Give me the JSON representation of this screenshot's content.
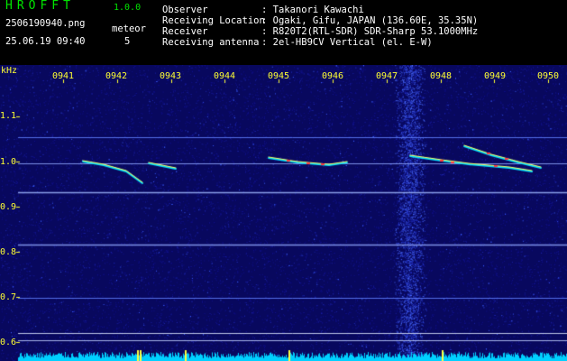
{
  "app": {
    "logo": "HROFFT",
    "version": "1.0.0"
  },
  "capture": {
    "filename": "2506190940.png",
    "datetime": "25.06.19 09:40",
    "event_label": "meteor",
    "event_count": "5"
  },
  "info": [
    {
      "key": "Observer",
      "value": ": Takanori Kawachi"
    },
    {
      "key": "Receiving Location",
      "value": ": Ogaki, Gifu, JAPAN (136.60E, 35.35N)"
    },
    {
      "key": "Receiver",
      "value": ": R820T2(RTL-SDR) SDR-Sharp 53.1000MHz"
    },
    {
      "key": "Receiving antenna",
      "value": ": 2el-HB9CV Vertical (el. E-W)"
    }
  ],
  "axes": {
    "y_unit": "kHz",
    "y_ticks": [
      "1.1",
      "1.0",
      "0.9",
      "0.8",
      "0.7",
      "0.6"
    ],
    "x_ticks": [
      "0941",
      "0942",
      "0943",
      "0944",
      "0945",
      "0946",
      "0947",
      "0948",
      "0949",
      "0950"
    ]
  },
  "colors": {
    "label": "#ffff33",
    "header_text": "#ffffff",
    "logo": "#00e600",
    "background": "#000000",
    "spectrum_floor": "#0a0a6a",
    "noise_cyan": "#00e6ff",
    "streak_hot": "#ff4040"
  }
}
